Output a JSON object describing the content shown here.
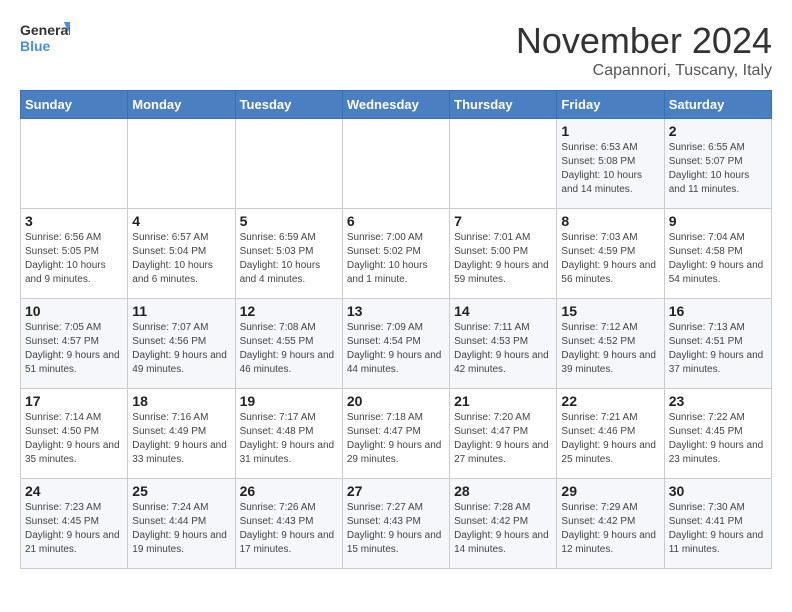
{
  "logo": {
    "line1": "General",
    "line2": "Blue"
  },
  "header": {
    "month": "November 2024",
    "location": "Capannori, Tuscany, Italy"
  },
  "weekdays": [
    "Sunday",
    "Monday",
    "Tuesday",
    "Wednesday",
    "Thursday",
    "Friday",
    "Saturday"
  ],
  "weeks": [
    [
      {
        "day": "",
        "info": ""
      },
      {
        "day": "",
        "info": ""
      },
      {
        "day": "",
        "info": ""
      },
      {
        "day": "",
        "info": ""
      },
      {
        "day": "",
        "info": ""
      },
      {
        "day": "1",
        "info": "Sunrise: 6:53 AM\nSunset: 5:08 PM\nDaylight: 10 hours and 14 minutes."
      },
      {
        "day": "2",
        "info": "Sunrise: 6:55 AM\nSunset: 5:07 PM\nDaylight: 10 hours and 11 minutes."
      }
    ],
    [
      {
        "day": "3",
        "info": "Sunrise: 6:56 AM\nSunset: 5:05 PM\nDaylight: 10 hours and 9 minutes."
      },
      {
        "day": "4",
        "info": "Sunrise: 6:57 AM\nSunset: 5:04 PM\nDaylight: 10 hours and 6 minutes."
      },
      {
        "day": "5",
        "info": "Sunrise: 6:59 AM\nSunset: 5:03 PM\nDaylight: 10 hours and 4 minutes."
      },
      {
        "day": "6",
        "info": "Sunrise: 7:00 AM\nSunset: 5:02 PM\nDaylight: 10 hours and 1 minute."
      },
      {
        "day": "7",
        "info": "Sunrise: 7:01 AM\nSunset: 5:00 PM\nDaylight: 9 hours and 59 minutes."
      },
      {
        "day": "8",
        "info": "Sunrise: 7:03 AM\nSunset: 4:59 PM\nDaylight: 9 hours and 56 minutes."
      },
      {
        "day": "9",
        "info": "Sunrise: 7:04 AM\nSunset: 4:58 PM\nDaylight: 9 hours and 54 minutes."
      }
    ],
    [
      {
        "day": "10",
        "info": "Sunrise: 7:05 AM\nSunset: 4:57 PM\nDaylight: 9 hours and 51 minutes."
      },
      {
        "day": "11",
        "info": "Sunrise: 7:07 AM\nSunset: 4:56 PM\nDaylight: 9 hours and 49 minutes."
      },
      {
        "day": "12",
        "info": "Sunrise: 7:08 AM\nSunset: 4:55 PM\nDaylight: 9 hours and 46 minutes."
      },
      {
        "day": "13",
        "info": "Sunrise: 7:09 AM\nSunset: 4:54 PM\nDaylight: 9 hours and 44 minutes."
      },
      {
        "day": "14",
        "info": "Sunrise: 7:11 AM\nSunset: 4:53 PM\nDaylight: 9 hours and 42 minutes."
      },
      {
        "day": "15",
        "info": "Sunrise: 7:12 AM\nSunset: 4:52 PM\nDaylight: 9 hours and 39 minutes."
      },
      {
        "day": "16",
        "info": "Sunrise: 7:13 AM\nSunset: 4:51 PM\nDaylight: 9 hours and 37 minutes."
      }
    ],
    [
      {
        "day": "17",
        "info": "Sunrise: 7:14 AM\nSunset: 4:50 PM\nDaylight: 9 hours and 35 minutes."
      },
      {
        "day": "18",
        "info": "Sunrise: 7:16 AM\nSunset: 4:49 PM\nDaylight: 9 hours and 33 minutes."
      },
      {
        "day": "19",
        "info": "Sunrise: 7:17 AM\nSunset: 4:48 PM\nDaylight: 9 hours and 31 minutes."
      },
      {
        "day": "20",
        "info": "Sunrise: 7:18 AM\nSunset: 4:47 PM\nDaylight: 9 hours and 29 minutes."
      },
      {
        "day": "21",
        "info": "Sunrise: 7:20 AM\nSunset: 4:47 PM\nDaylight: 9 hours and 27 minutes."
      },
      {
        "day": "22",
        "info": "Sunrise: 7:21 AM\nSunset: 4:46 PM\nDaylight: 9 hours and 25 minutes."
      },
      {
        "day": "23",
        "info": "Sunrise: 7:22 AM\nSunset: 4:45 PM\nDaylight: 9 hours and 23 minutes."
      }
    ],
    [
      {
        "day": "24",
        "info": "Sunrise: 7:23 AM\nSunset: 4:45 PM\nDaylight: 9 hours and 21 minutes."
      },
      {
        "day": "25",
        "info": "Sunrise: 7:24 AM\nSunset: 4:44 PM\nDaylight: 9 hours and 19 minutes."
      },
      {
        "day": "26",
        "info": "Sunrise: 7:26 AM\nSunset: 4:43 PM\nDaylight: 9 hours and 17 minutes."
      },
      {
        "day": "27",
        "info": "Sunrise: 7:27 AM\nSunset: 4:43 PM\nDaylight: 9 hours and 15 minutes."
      },
      {
        "day": "28",
        "info": "Sunrise: 7:28 AM\nSunset: 4:42 PM\nDaylight: 9 hours and 14 minutes."
      },
      {
        "day": "29",
        "info": "Sunrise: 7:29 AM\nSunset: 4:42 PM\nDaylight: 9 hours and 12 minutes."
      },
      {
        "day": "30",
        "info": "Sunrise: 7:30 AM\nSunset: 4:41 PM\nDaylight: 9 hours and 11 minutes."
      }
    ]
  ]
}
